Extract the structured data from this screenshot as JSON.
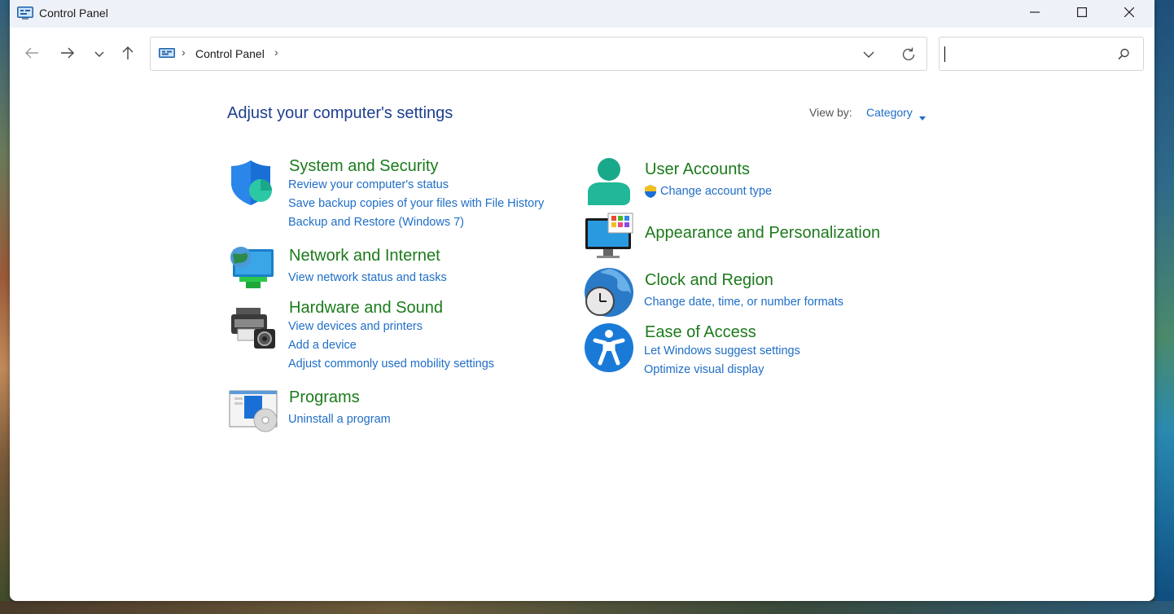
{
  "window": {
    "title": "Control Panel",
    "minimize_label": "Minimize",
    "maximize_label": "Maximize",
    "close_label": "Close"
  },
  "address": {
    "path_label": "Control Panel",
    "separator": "›"
  },
  "search": {
    "value": "",
    "placeholder": ""
  },
  "main": {
    "heading": "Adjust your computer's settings",
    "view_by_label": "View by:",
    "view_by_value": "Category"
  },
  "categories": {
    "system_security": {
      "title": "System and Security",
      "links": [
        "Review your computer's status",
        "Save backup copies of your files with File History",
        "Backup and Restore (Windows 7)"
      ]
    },
    "network_internet": {
      "title": "Network and Internet",
      "links": [
        "View network status and tasks"
      ]
    },
    "hardware_sound": {
      "title": "Hardware and Sound",
      "links": [
        "View devices and printers",
        "Add a device",
        "Adjust commonly used mobility settings"
      ]
    },
    "programs": {
      "title": "Programs",
      "links": [
        "Uninstall a program"
      ]
    },
    "user_accounts": {
      "title": "User Accounts",
      "links": [
        "Change account type"
      ]
    },
    "appearance": {
      "title": "Appearance and Personalization",
      "links": []
    },
    "clock_region": {
      "title": "Clock and Region",
      "links": [
        "Change date, time, or number formats"
      ]
    },
    "ease_access": {
      "title": "Ease of Access",
      "links": [
        "Let Windows suggest settings",
        "Optimize visual display"
      ]
    }
  },
  "icons": {
    "app": "control-panel-icon",
    "back": "arrow-left-icon",
    "forward": "arrow-right-icon",
    "recent": "chevron-down-icon",
    "up": "arrow-up-icon",
    "refresh": "refresh-icon",
    "search": "search-icon"
  },
  "colors": {
    "heading": "#1e3f8f",
    "category_title": "#1c7a1c",
    "link": "#1f6ec6",
    "titlebar": "#eef2f8"
  }
}
